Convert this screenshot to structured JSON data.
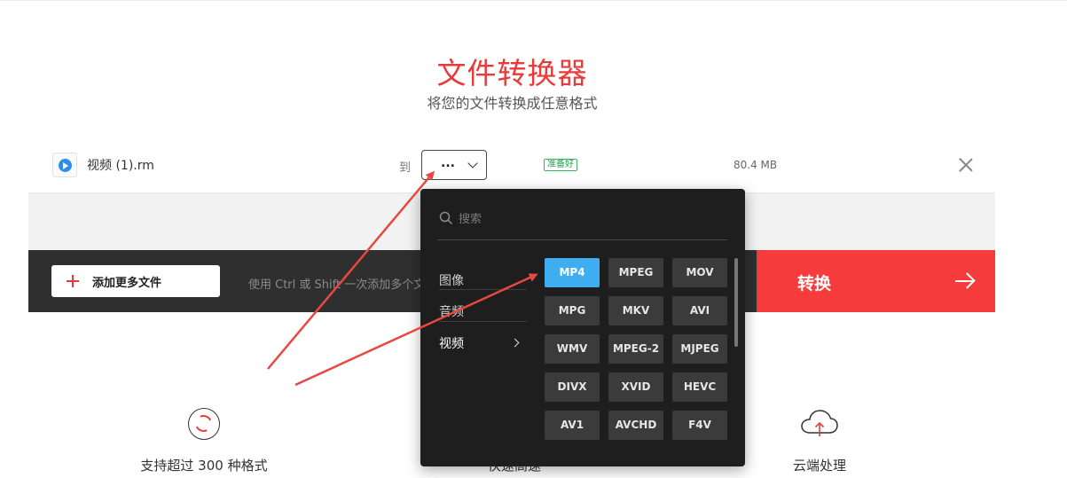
{
  "header": {
    "title": "文件转换器",
    "subtitle": "将您的文件转换成任意格式"
  },
  "file": {
    "name": "视频 (1).rm",
    "to_label": "到",
    "selected_format": "...",
    "status": "准备好",
    "size": "80.4 MB"
  },
  "toolbar": {
    "add_files_label": "添加更多文件",
    "hint_text": "使用 Ctrl 或 Shift 一次添加多个文件",
    "convert_label": "转换"
  },
  "dropdown": {
    "search_placeholder": "搜索",
    "categories": [
      {
        "label": "图像"
      },
      {
        "label": "音频"
      },
      {
        "label": "视频"
      }
    ],
    "formats": [
      [
        "MP4",
        "MPEG",
        "MOV"
      ],
      [
        "MPG",
        "MKV",
        "AVI"
      ],
      [
        "WMV",
        "MPEG-2",
        "MJPEG"
      ],
      [
        "DIVX",
        "XVID",
        "HEVC"
      ],
      [
        "AV1",
        "AVCHD",
        "F4V"
      ]
    ],
    "selected_format": "MP4"
  },
  "features": [
    {
      "label": "支持超过 300 种格式",
      "icon": "sync-icon"
    },
    {
      "label": "快速高速",
      "icon": "speed-icon"
    },
    {
      "label": "云端处理",
      "icon": "cloud-upload-icon"
    }
  ],
  "colors": {
    "accent_red": "#f53b3b",
    "title_red": "#e83a3a",
    "selected_blue": "#3eaef0",
    "dropdown_bg": "#1e1e1e",
    "ready_green": "#23a04a"
  }
}
